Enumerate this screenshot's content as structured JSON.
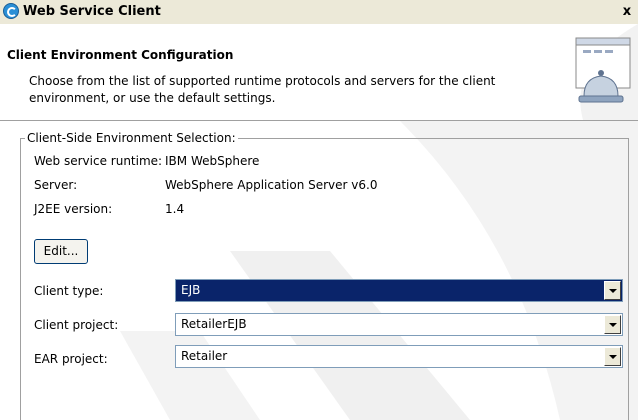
{
  "window": {
    "title": "Web Service Client",
    "close_label": "x"
  },
  "banner": {
    "title": "Client Environment Configuration",
    "description": "Choose from the list of supported runtime protocols and servers for the client environment, or use the default settings."
  },
  "environment": {
    "group_label": "Client-Side Environment Selection:",
    "runtime_label": "Web service runtime:",
    "runtime_value": "IBM WebSphere",
    "server_label": "Server:",
    "server_value": "WebSphere Application Server v6.0",
    "j2ee_label": "J2EE version:",
    "j2ee_value": "1.4",
    "edit_button": "Edit..."
  },
  "fields": {
    "client_type_label": "Client type:",
    "client_type_value": "EJB",
    "client_project_label": "Client project:",
    "client_project_value": "RetailerEJB",
    "ear_project_label": "EAR project:",
    "ear_project_value": "Retailer"
  },
  "colors": {
    "selection": "#0a246a",
    "dialog_bg": "#ece9d8",
    "watermark": "#eeeeee"
  },
  "icons": {
    "app_icon": "eclipse-icon",
    "banner_icon": "service-bell-icon"
  }
}
